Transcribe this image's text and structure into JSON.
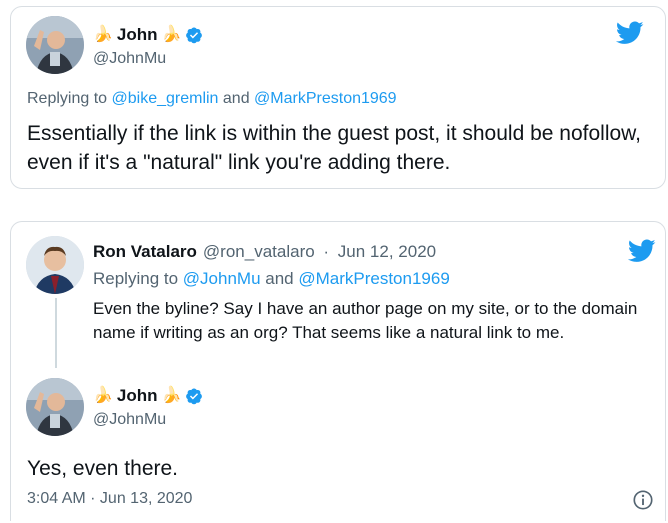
{
  "tweet1": {
    "name": "John",
    "emoji": "🍌",
    "handle": "@JohnMu",
    "reply_prefix": "Replying to ",
    "reply_user1": "@bike_gremlin",
    "reply_and": " and ",
    "reply_user2": "@MarkPreston1969",
    "text": "Essentially if the link is within the guest post, it should be nofollow, even if it's a \"natural\" link you're adding there."
  },
  "tweet2": {
    "name": "Ron Vatalaro",
    "handle": "@ron_vatalaro",
    "separator": " · ",
    "date": "Jun 12, 2020",
    "reply_prefix": "Replying to ",
    "reply_user1": "@JohnMu",
    "reply_and": " and ",
    "reply_user2": "@MarkPreston1969",
    "text": "Even the byline? Say I have an author page on my site, or to the domain name if writing as an org? That seems like a natural link to me."
  },
  "tweet3": {
    "name": "John",
    "emoji": "🍌",
    "handle": "@JohnMu",
    "text": "Yes, even there.",
    "timestamp": "3:04 AM · Jun 13, 2020"
  },
  "icons": {
    "brand": "twitter-bird-icon",
    "verified": "verified-badge-icon",
    "info": "info-icon"
  },
  "colors": {
    "link": "#1d9bf0",
    "muted": "#536471",
    "text": "#0f1419",
    "border": "#d9dee3"
  }
}
